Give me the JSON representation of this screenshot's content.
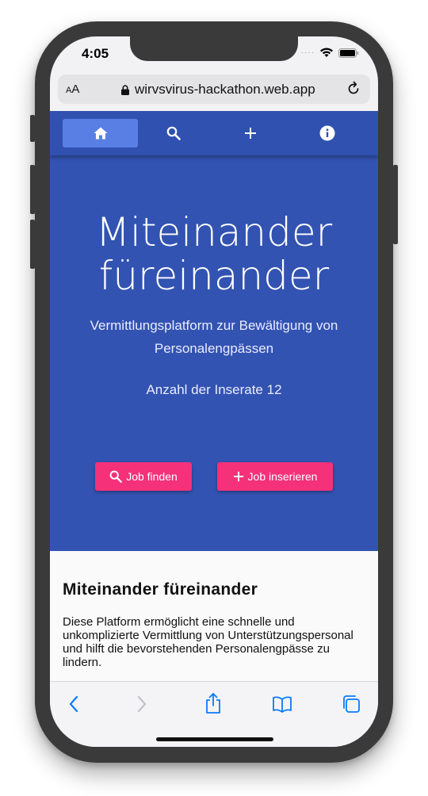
{
  "status": {
    "time": "4:05"
  },
  "browser": {
    "text_size": "AA",
    "url": "wirvsvirus-hackathon.web.app"
  },
  "nav": {
    "items": [
      "home",
      "search",
      "add",
      "info"
    ],
    "active": "home",
    "bar_color": "#3151b0",
    "active_color": "#5a7fe4"
  },
  "hero": {
    "title_line1": "Miteinander",
    "title_line2": "füreinander",
    "subtitle": "Vermittlungsplatform zur Bewältigung von Personalengpässen",
    "count_label": "Anzahl der Inserate 12",
    "background": "#3353b2"
  },
  "buttons": {
    "find_job": "Job finden",
    "post_job": "Job inserieren",
    "color": "#f5317a"
  },
  "section": {
    "title": "Miteinander füreinander",
    "body": "Diese Platform ermöglicht eine schnelle und unkomplizierte Vermittlung von Unterstützungspersonal und hilft die bevorstehenden Personalengpässe zu lindern."
  },
  "toolbar": {
    "items": [
      "back-icon",
      "forward-icon",
      "share-icon",
      "bookmarks-icon",
      "tabs-icon"
    ],
    "accent": "#0a7aff"
  }
}
